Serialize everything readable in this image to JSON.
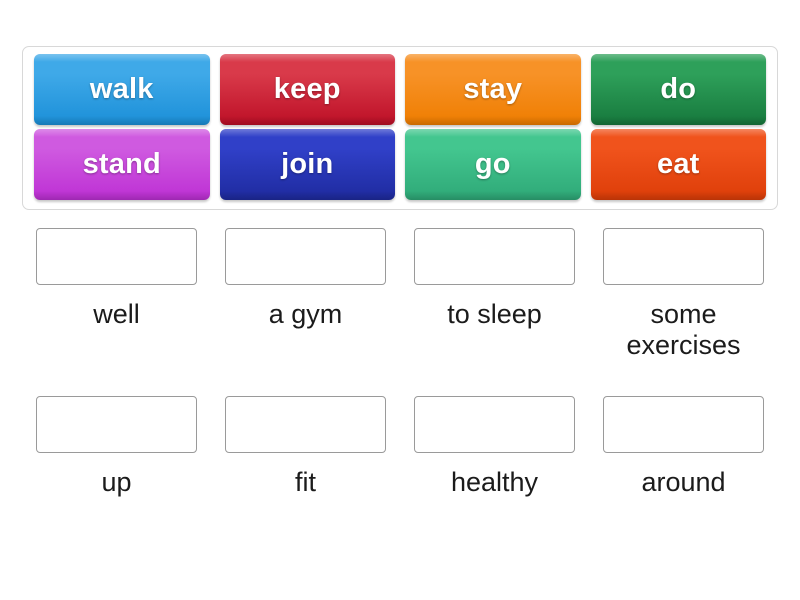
{
  "activity": {
    "type": "match-up-drag-and-drop",
    "background_color": "#ffffff"
  },
  "tile_tray": {
    "border_color": "#d8d8d8",
    "rows": [
      [
        {
          "label": "walk",
          "color_top": "#3fa9e8",
          "color_bottom": "#1b8fd8",
          "name": "tile-walk"
        },
        {
          "label": "keep",
          "color_top": "#d93a4a",
          "color_bottom": "#bd0f26",
          "name": "tile-keep"
        },
        {
          "label": "stay",
          "color_top": "#f79227",
          "color_bottom": "#ef7d00",
          "name": "tile-stay"
        },
        {
          "label": "do",
          "color_top": "#2ea05a",
          "color_bottom": "#16783c",
          "name": "tile-do"
        }
      ],
      [
        {
          "label": "stand",
          "color_top": "#cf5ae0",
          "color_bottom": "#bd2fd4",
          "name": "tile-stand"
        },
        {
          "label": "join",
          "color_top": "#3040c8",
          "color_bottom": "#1e2a9e",
          "name": "tile-join"
        },
        {
          "label": "go",
          "color_top": "#43c68f",
          "color_bottom": "#2ea877",
          "name": "tile-go"
        },
        {
          "label": "eat",
          "color_top": "#f0531c",
          "color_bottom": "#dd3d08",
          "name": "tile-eat"
        }
      ]
    ]
  },
  "answers": {
    "dropzone_border_color": "#9a9a9a",
    "label_color": "#1b1b1b",
    "rows": [
      [
        {
          "label": "well",
          "dropzone_value": "",
          "name": "answer-well"
        },
        {
          "label": "a gym",
          "dropzone_value": "",
          "name": "answer-a-gym"
        },
        {
          "label": "to sleep",
          "dropzone_value": "",
          "name": "answer-to-sleep"
        },
        {
          "label": "some exercises",
          "dropzone_value": "",
          "name": "answer-some-exercises"
        }
      ],
      [
        {
          "label": "up",
          "dropzone_value": "",
          "name": "answer-up"
        },
        {
          "label": "fit",
          "dropzone_value": "",
          "name": "answer-fit"
        },
        {
          "label": "healthy",
          "dropzone_value": "",
          "name": "answer-healthy"
        },
        {
          "label": "around",
          "dropzone_value": "",
          "name": "answer-around"
        }
      ]
    ]
  }
}
